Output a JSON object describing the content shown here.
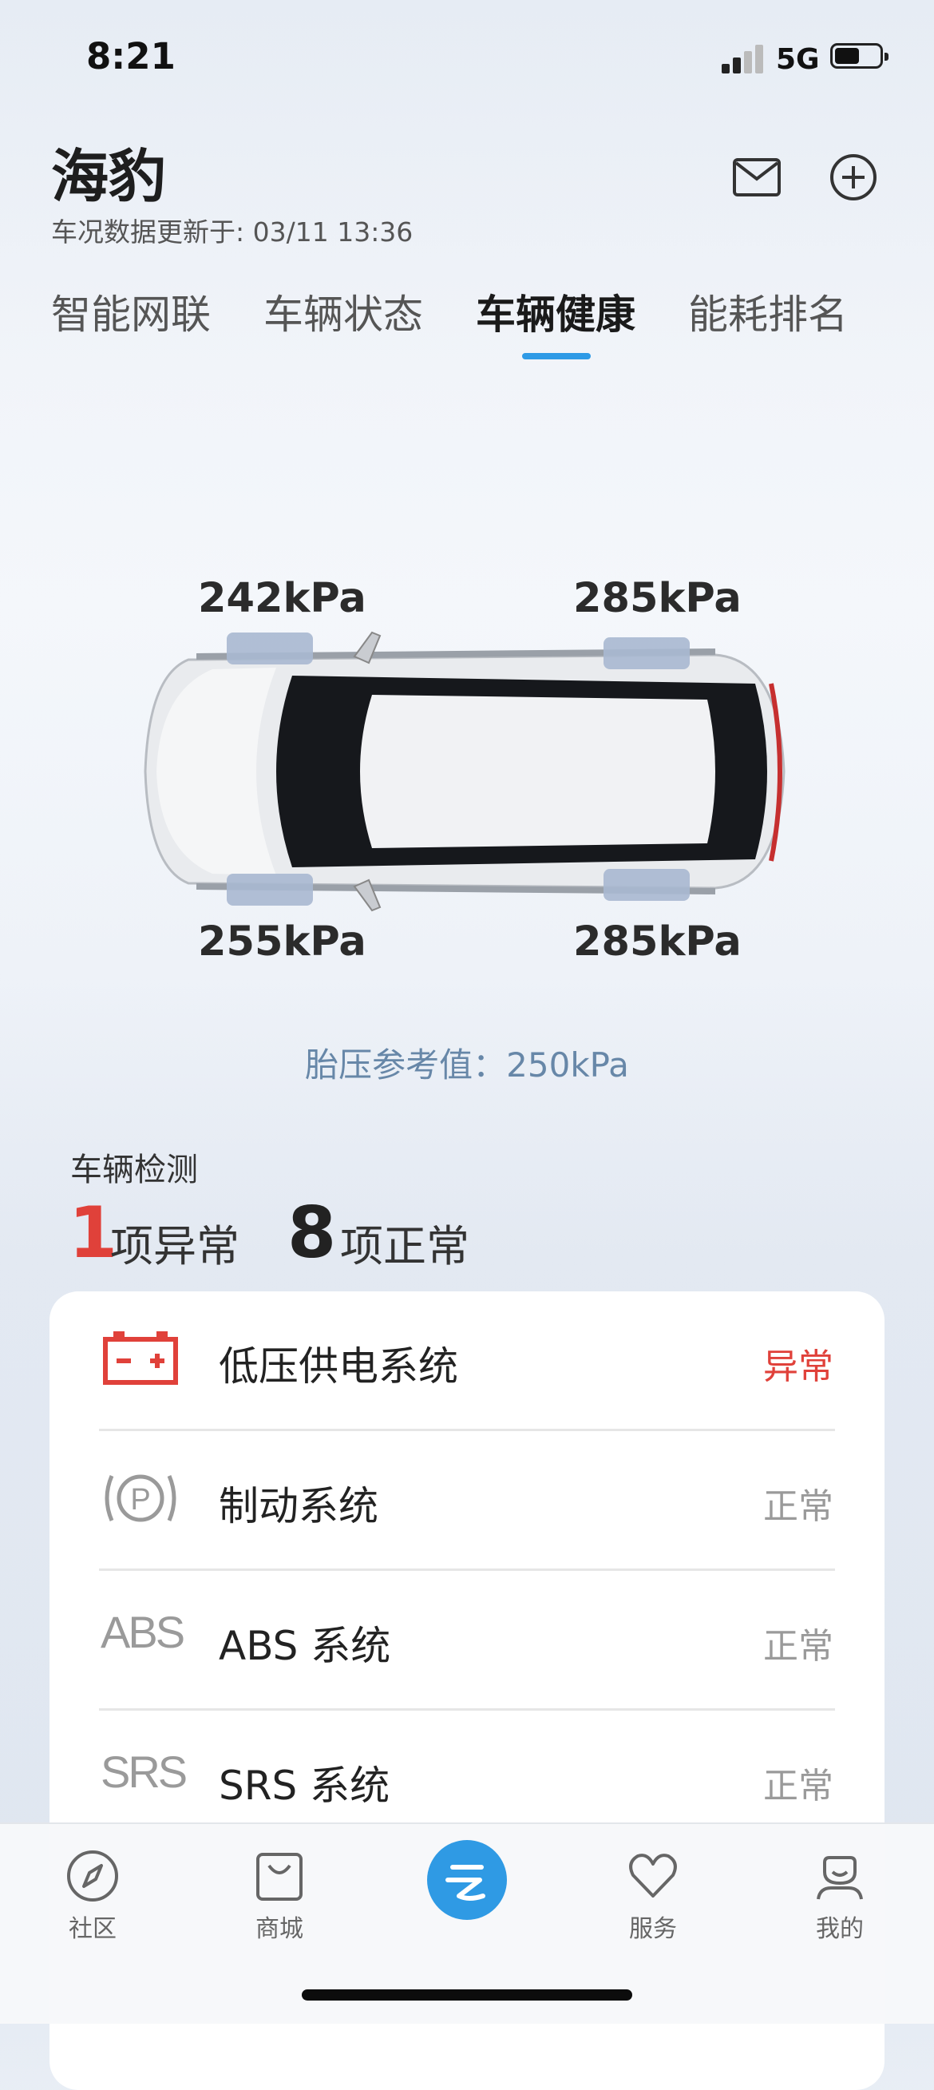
{
  "status_bar": {
    "time": "8:21",
    "network": "5G"
  },
  "header": {
    "title": "海豹",
    "subtitle": "车况数据更新于: 03/11 13:36",
    "icons": [
      "mail-icon",
      "add-icon"
    ]
  },
  "tabs": [
    {
      "label": "智能网联",
      "active": false
    },
    {
      "label": "车辆状态",
      "active": false
    },
    {
      "label": "车辆健康",
      "active": true
    },
    {
      "label": "能耗排名",
      "active": false
    }
  ],
  "tire_pressure": {
    "front_left": "242kPa",
    "front_right": "285kPa",
    "rear_left": "255kPa",
    "rear_right": "285kPa",
    "reference": "胎压参考值：250kPa"
  },
  "detection": {
    "title": "车辆检测",
    "abnormal_count": "1",
    "abnormal_label": "项异常",
    "normal_count": "8",
    "normal_label": "项正常"
  },
  "systems": [
    {
      "icon": "battery-icon",
      "name": "低压供电系统",
      "status": "异常",
      "abnormal": true
    },
    {
      "icon": "parking-brake-icon",
      "name": "制动系统",
      "status": "正常",
      "abnormal": false
    },
    {
      "icon": "abs-icon",
      "icon_text": "ABS",
      "name": "ABS 系统",
      "status": "正常",
      "abnormal": false
    },
    {
      "icon": "srs-icon",
      "icon_text": "SRS",
      "name": "SRS 系统",
      "status": "正常",
      "abnormal": false
    }
  ],
  "bottom_nav": [
    {
      "label": "社区",
      "icon": "compass-icon"
    },
    {
      "label": "商城",
      "icon": "shopping-bag-icon"
    },
    {
      "label": "",
      "icon": "cloud-icon"
    },
    {
      "label": "服务",
      "icon": "heart-icon"
    },
    {
      "label": "我的",
      "icon": "profile-icon"
    }
  ],
  "colors": {
    "accent": "#2e9ae6",
    "abnormal": "#e0413a",
    "normal": "#9a9a9a",
    "reference_text": "#6787a8"
  }
}
